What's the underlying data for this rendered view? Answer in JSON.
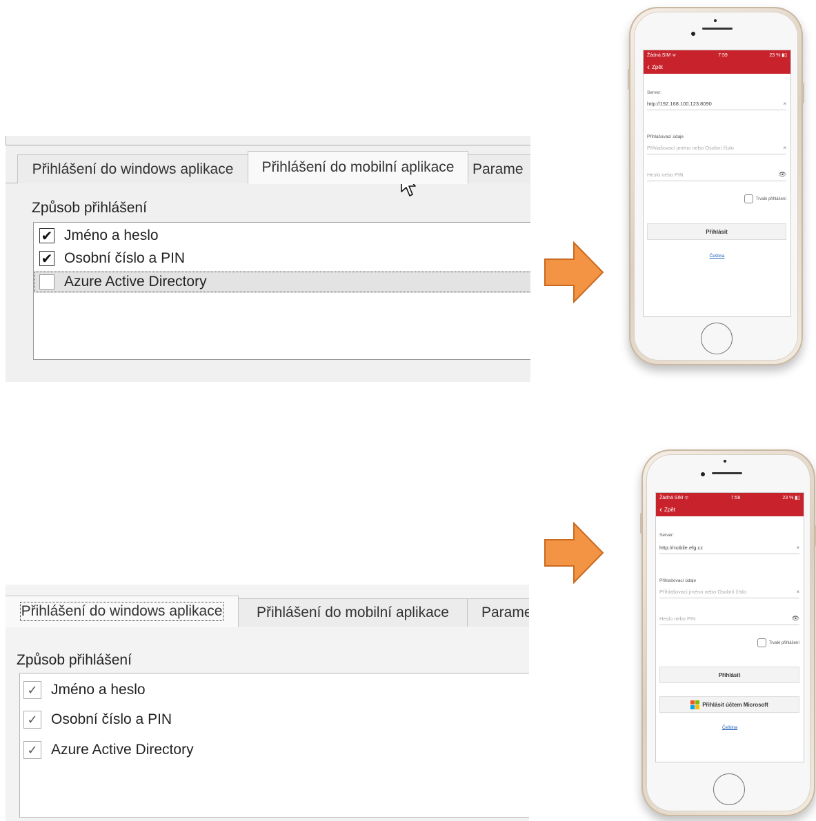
{
  "top_dialog": {
    "tabs": [
      "Přihlášení do windows aplikace",
      "Přihlášení do mobilní aplikace",
      "Parame"
    ],
    "active_tab": 1,
    "group_label": "Způsob přihlášení",
    "items": [
      {
        "label": "Jméno a heslo",
        "checked": true
      },
      {
        "label": "Osobní číslo a PIN",
        "checked": true
      },
      {
        "label": "Azure Active Directory",
        "checked": false,
        "selected": true
      }
    ]
  },
  "bottom_dialog": {
    "tabs": [
      "Přihlášení do windows aplikace",
      "Přihlášení do mobilní aplikace",
      "Parame"
    ],
    "active_tab": 0,
    "group_label": "Způsob přihlášení",
    "items": [
      {
        "label": "Jméno a heslo",
        "checked": true
      },
      {
        "label": "Osobní číslo a PIN",
        "checked": true
      },
      {
        "label": "Azure Active Directory",
        "checked": true
      }
    ]
  },
  "arrow_color": "#f39445",
  "phone_top": {
    "status_left": "Žádná SIM ᯤ",
    "status_time": "7:59",
    "status_right": "23 % ▮▯",
    "back_label": "Zpět",
    "server_label": "Server:",
    "server_value": "http://192.168.100.123:8090",
    "login_label": "Přihlašovací údaje",
    "login_placeholder": "Přihlašovací jméno nebo Osobní číslo",
    "password_placeholder": "Heslo nebo PIN",
    "remember_label": "Trvalé přihlášení",
    "login_button": "Přihlásit",
    "language_link": "Čeština",
    "clear_icon": "×",
    "eye_icon": "👁"
  },
  "phone_bottom": {
    "status_left": "Žádná SIM ᯤ",
    "status_time": "7:58",
    "status_right": "23 % ▮▯",
    "back_label": "Zpět",
    "server_label": "Server:",
    "server_value": "http://mobile.efg.cz",
    "login_label": "Přihlašovací údaje",
    "login_placeholder": "Přihlašovací jméno nebo Osobní číslo",
    "password_placeholder": "Heslo nebo PIN",
    "remember_label": "Trvalé přihlášení",
    "login_button": "Přihlásit",
    "microsoft_button": "Přihlásit účtem Microsoft",
    "language_link": "Čeština",
    "clear_icon": "×",
    "eye_icon": "👁"
  },
  "brand_red": "#c8232c",
  "ms_colors": [
    "#f25022",
    "#7fba00",
    "#00a4ef",
    "#ffb900"
  ]
}
